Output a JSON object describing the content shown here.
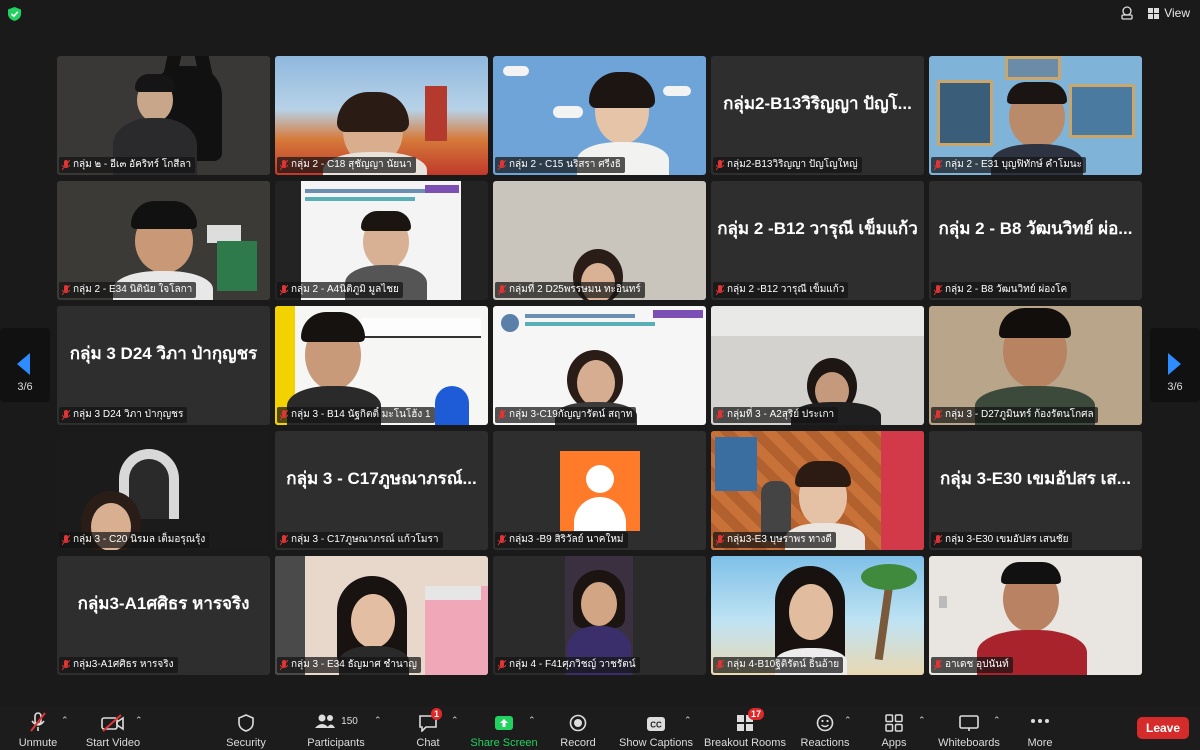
{
  "window": {
    "view_label": "View"
  },
  "pager": {
    "left": "3/6",
    "right": "3/6"
  },
  "tiles": [
    {
      "label": "กลุ่ม ๒ - อีเ๓ อัคริทร์ โกสีลา",
      "name": ""
    },
    {
      "label": "กลุ่ม 2 - C18 สุชัญญา นัยนา",
      "name": ""
    },
    {
      "label": "กลุ่ม 2 - C15 นริสรา ศรีงธิ",
      "name": ""
    },
    {
      "label": "กลุ่ม2-B13วิริญญา ปัญโญใหญ่",
      "name": "กลุ่ม2-B13วิริญญา ปัญโ..."
    },
    {
      "label": "กลุ่ม 2 - E31 บุญฟิทักษ์ คำโมนะ",
      "name": ""
    },
    {
      "label": "กลุ่ม 2 - E34 นิตินัย ใจโลกา",
      "name": ""
    },
    {
      "label": "กลุ่ม 2 - A4นิติภูมิ มูลไชย",
      "name": ""
    },
    {
      "label": "กลุ่มที่ 2 D25พรรษมน ทะอินทร์",
      "name": ""
    },
    {
      "label": "กลุ่ม 2 -B12 วารุณี เข็มแก้ว",
      "name": "กลุ่ม 2 -B12 วารุณี เข็มแก้ว"
    },
    {
      "label": "กลุ่ม 2 - B8 วัฒนวิทย์ ผ่องโค",
      "name": "กลุ่ม 2 - B8 วัฒนวิทย์ ผ่อ..."
    },
    {
      "label": "กลุ่ม 3 D24 วิภา ป่ากุญชร",
      "name": "กลุ่ม 3 D24 วิภา ป่ากุญชร"
    },
    {
      "label": "กลุ่ม 3 - B14 นัฐกิตติ์ มะโนโฮ้ง 1",
      "name": ""
    },
    {
      "label": "กลุ่ม 3-C19กัญญารัตน์ สฤาท",
      "name": ""
    },
    {
      "label": "กลุ่มที่ 3 - A2สุริย์ ประเกา",
      "name": ""
    },
    {
      "label": "กลุ่ม 3 - D27ภูมินทร์ ก้องรัตนโกศล",
      "name": ""
    },
    {
      "label": "กลุ่ม 3 - C20 นิรมล เต็มอรุณรุ้ง",
      "name": ""
    },
    {
      "label": "กลุ่ม 3 - C17ภูษณาภรณ์ แก้วโมรา",
      "name": "กลุ่ม 3 - C17ภูษณาภรณ์..."
    },
    {
      "label": "กลุ่ม3 -B9 สิริวัลย์ นาคใหม่",
      "name": ""
    },
    {
      "label": "กลุ่ม3-E3 บุษราพร ทางดี",
      "name": ""
    },
    {
      "label": "กลุ่ม 3-E30 เขมอัปสร เสนชัย",
      "name": "กลุ่ม 3-E30 เขมอัปสร เส..."
    },
    {
      "label": "กลุ่ม3-A1ศศิธร หารจริง",
      "name": "กลุ่ม3-A1ศศิธร หารจริง"
    },
    {
      "label": "กลุ่ม 3 - E34 ธัญมาศ ชำนาญ",
      "name": ""
    },
    {
      "label": "กลุ่ม 4 - F41ศุภวิชญ์ วาชรัตน์",
      "name": ""
    },
    {
      "label": "กลุ่ม 4-B10ฐิติรัตน์ ธิ้นอ้าย",
      "name": ""
    },
    {
      "label": "อาเดช อุปนันท์",
      "name": ""
    }
  ],
  "toolbar": {
    "unmute": "Unmute",
    "start_video": "Start Video",
    "security": "Security",
    "participants": "Participants",
    "participants_count": "150",
    "chat": "Chat",
    "chat_badge": "1",
    "share_screen": "Share Screen",
    "record": "Record",
    "captions": "Show Captions",
    "breakout": "Breakout Rooms",
    "breakout_badge": "17",
    "reactions": "Reactions",
    "apps": "Apps",
    "whiteboards": "Whiteboards",
    "more": "More",
    "leave": "Leave"
  },
  "colors": {
    "accent_green": "#23d160",
    "leave_red": "#d52b2b",
    "nav_blue": "#2d8cff"
  }
}
